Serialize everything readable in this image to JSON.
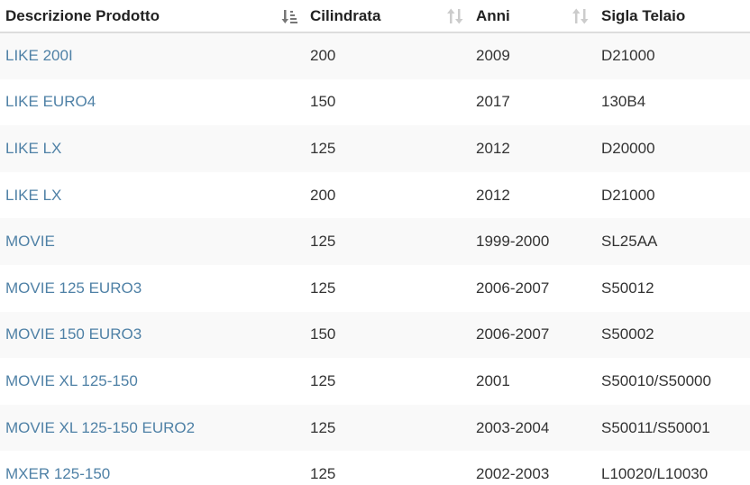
{
  "table": {
    "headers": [
      {
        "label": "Descrizione Prodotto",
        "sort": "sort-amount-active-icon"
      },
      {
        "label": "Cilindrata",
        "sort": "sort-both-icon"
      },
      {
        "label": "Anni",
        "sort": "sort-both-icon"
      },
      {
        "label": "Sigla Telaio",
        "sort": "none"
      }
    ],
    "rows": [
      {
        "prodotto": "LIKE 200I",
        "cilindrata": "200",
        "anni": "2009",
        "telaio": "D21000"
      },
      {
        "prodotto": "LIKE EURO4",
        "cilindrata": "150",
        "anni": "2017",
        "telaio": "130B4"
      },
      {
        "prodotto": "LIKE LX",
        "cilindrata": "125",
        "anni": "2012",
        "telaio": "D20000"
      },
      {
        "prodotto": "LIKE LX",
        "cilindrata": "200",
        "anni": "2012",
        "telaio": "D21000"
      },
      {
        "prodotto": "MOVIE",
        "cilindrata": "125",
        "anni": "1999-2000",
        "telaio": "SL25AA"
      },
      {
        "prodotto": "MOVIE 125 EURO3",
        "cilindrata": "125",
        "anni": "2006-2007",
        "telaio": "S50012"
      },
      {
        "prodotto": "MOVIE 150 EURO3",
        "cilindrata": "150",
        "anni": "2006-2007",
        "telaio": "S50002"
      },
      {
        "prodotto": "MOVIE XL 125-150",
        "cilindrata": "125",
        "anni": "2001",
        "telaio": "S50010/S50000"
      },
      {
        "prodotto": "MOVIE XL 125-150 EURO2",
        "cilindrata": "125",
        "anni": "2003-2004",
        "telaio": "S50011/S50001"
      },
      {
        "prodotto": "MXER 125-150",
        "cilindrata": "125",
        "anni": "2002-2003",
        "telaio": "L10020/L10030"
      }
    ]
  },
  "colors": {
    "link": "#4f81a6",
    "stripe": "#f9f9f9",
    "header_border": "#dddddd",
    "sort_active": "#777777",
    "sort_inactive": "#cccccc"
  }
}
